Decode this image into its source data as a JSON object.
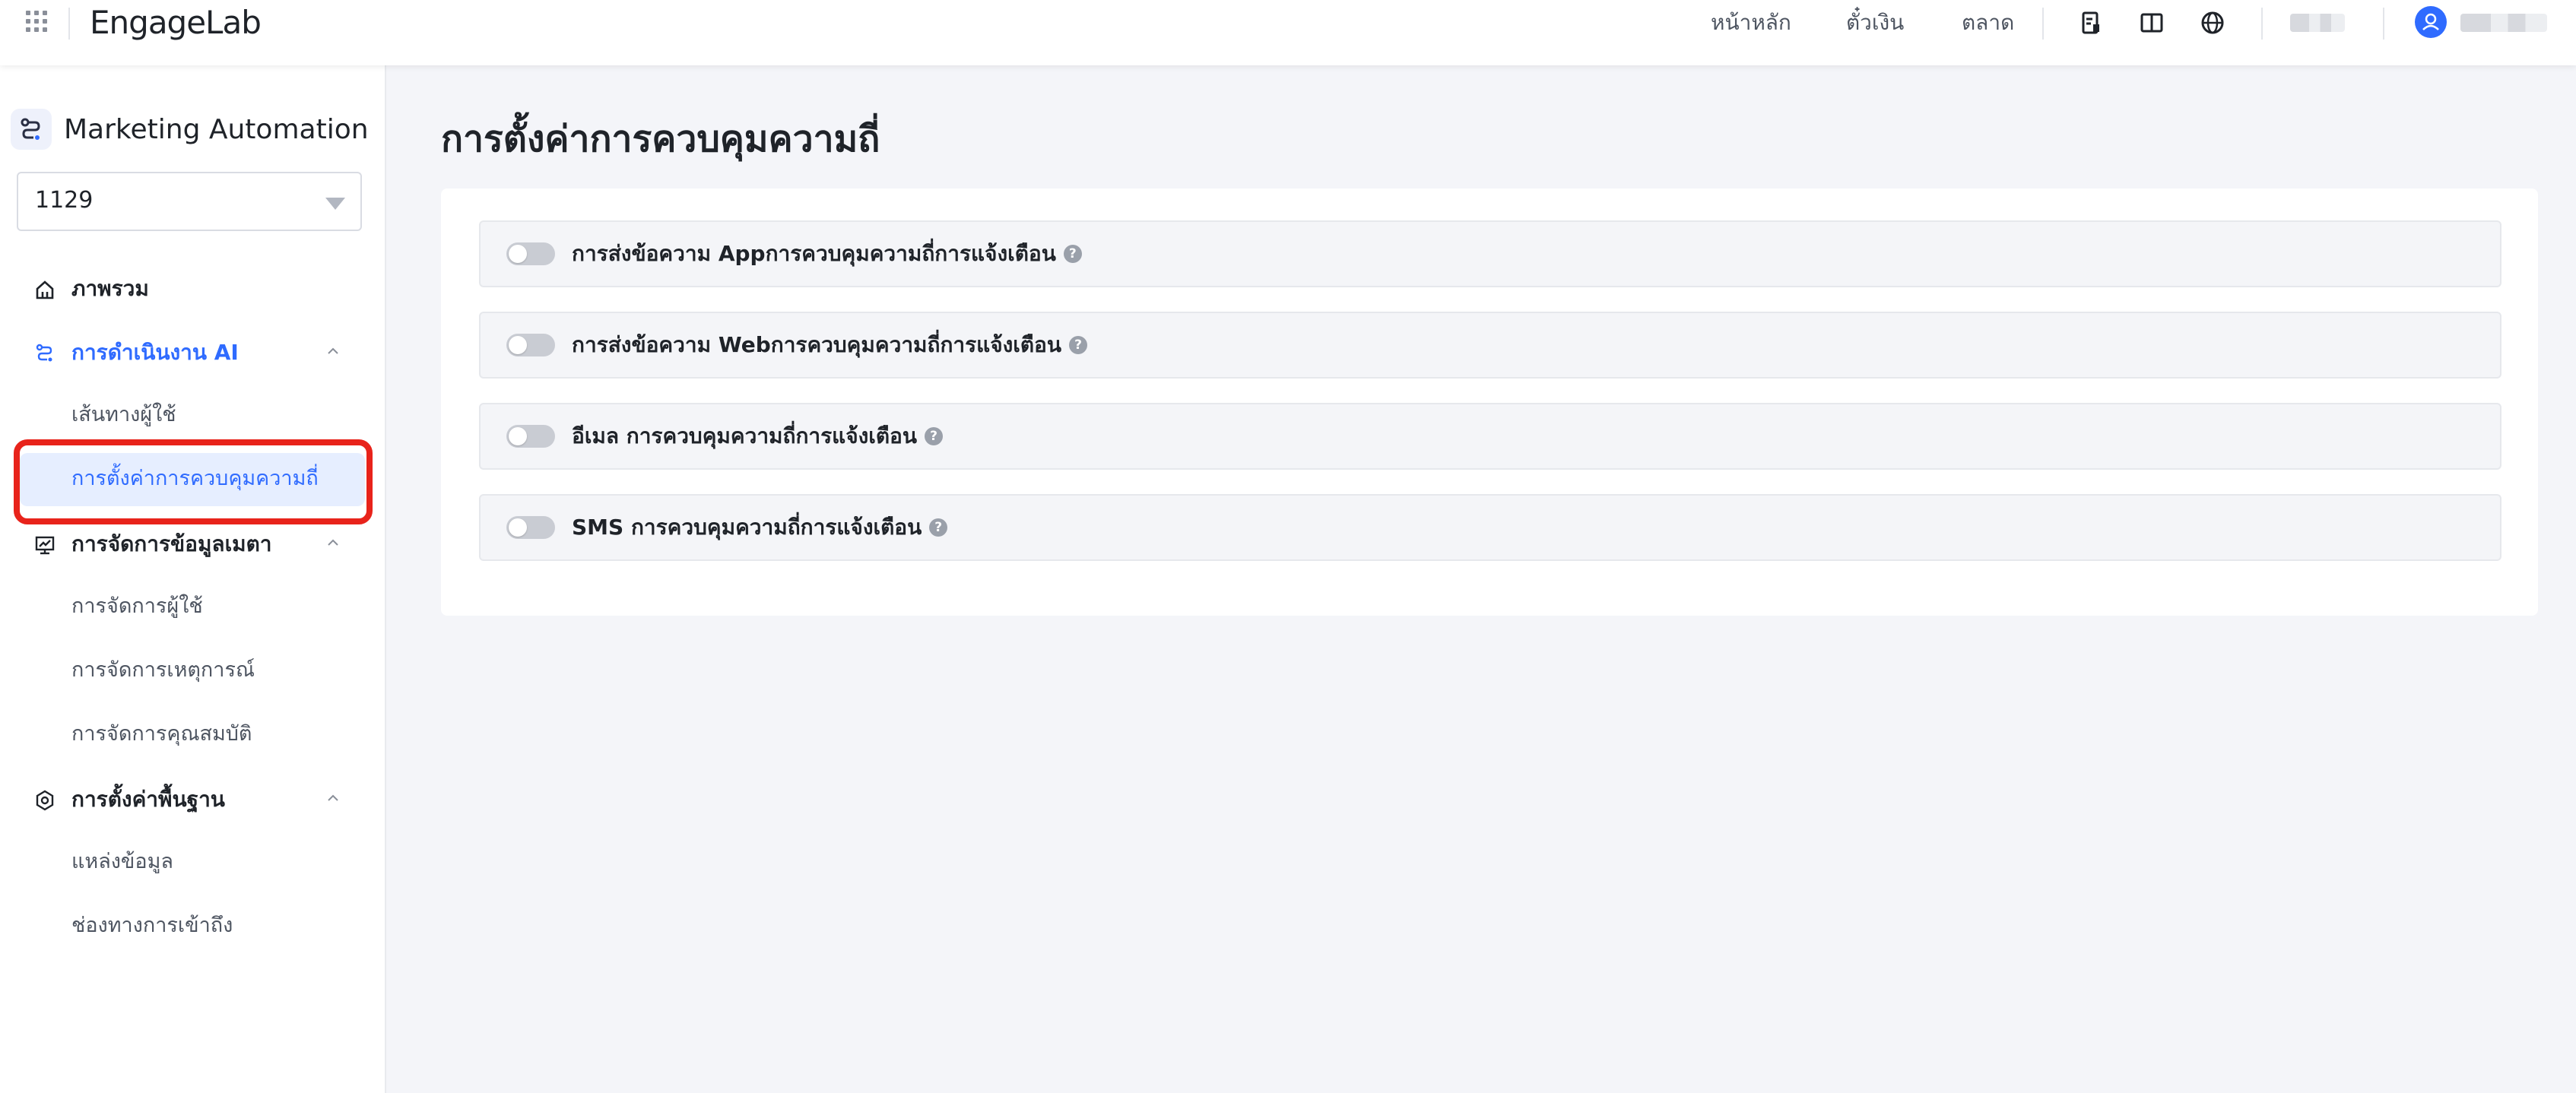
{
  "brand": {
    "logo_text": "EngageLab"
  },
  "topnav": {
    "links": [
      "หน้าหลัก",
      "ตั๋วเงิน",
      "ตลาด"
    ],
    "icons": [
      "document-icon",
      "split-view-icon",
      "globe-icon"
    ]
  },
  "sidebar": {
    "product_name": "Marketing Automation",
    "selector_value": "1129",
    "groups": [
      {
        "label": "ภาพรวม",
        "icon": "home-icon",
        "items": []
      },
      {
        "label": "การดำเนินงาน AI",
        "icon": "flow-icon",
        "active": true,
        "items": [
          {
            "label": "เส้นทางผู้ใช้"
          },
          {
            "label": "การตั้งค่าการควบคุมความถี่",
            "active": true
          }
        ]
      },
      {
        "label": "การจัดการข้อมูลเมตา",
        "icon": "chart-board-icon",
        "items": [
          {
            "label": "การจัดการผู้ใช้"
          },
          {
            "label": "การจัดการเหตุการณ์"
          },
          {
            "label": "การจัดการคุณสมบัติ"
          }
        ]
      },
      {
        "label": "การตั้งค่าพื้นฐาน",
        "icon": "settings-hex-icon",
        "items": [
          {
            "label": "แหล่งข้อมูล"
          },
          {
            "label": "ช่องทางการเข้าถึง"
          }
        ]
      }
    ]
  },
  "main": {
    "title": "การตั้งค่าการควบคุมความถี่",
    "settings": [
      {
        "label": "การส่งข้อความ Appการควบคุมความถี่การแจ้งเตือน",
        "enabled": false
      },
      {
        "label": "การส่งข้อความ Webการควบคุมความถี่การแจ้งเตือน",
        "enabled": false
      },
      {
        "label": "อีเมล การควบคุมความถี่การแจ้งเตือน",
        "enabled": false
      },
      {
        "label": "SMS การควบคุมความถี่การแจ้งเตือน",
        "enabled": false
      }
    ],
    "help_glyph": "?"
  },
  "colors": {
    "accent": "#2f6bff",
    "highlight": "#e8231b"
  }
}
